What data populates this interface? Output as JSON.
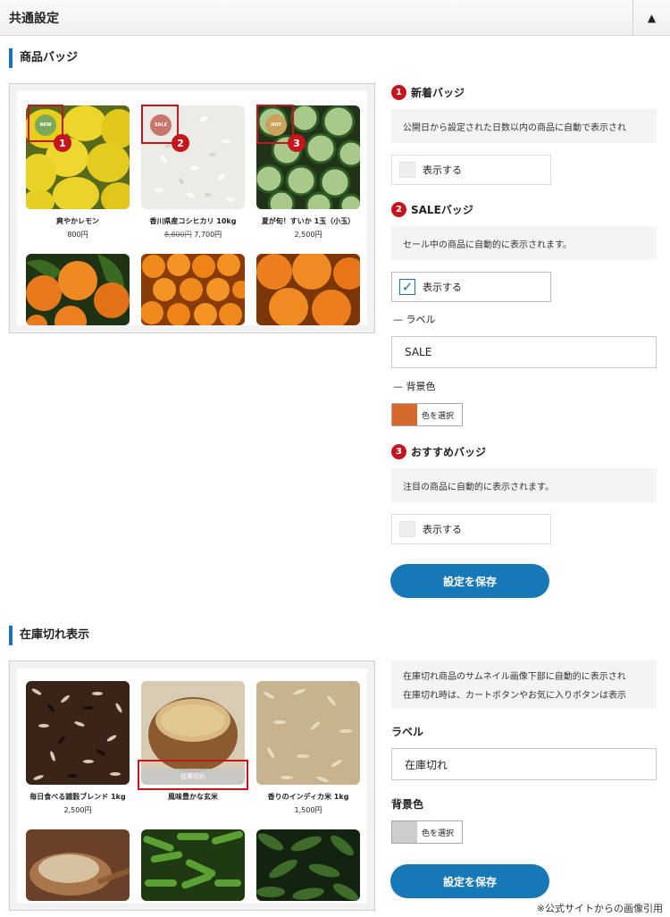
{
  "header": {
    "title": "共通設定",
    "collapse_icon": "▲"
  },
  "badges_section": {
    "title": "商品バッジ",
    "products": [
      {
        "name": "爽やかレモン",
        "price": "800円",
        "old_price": "",
        "badge": "NEW",
        "badge_color": "#7ca85a"
      },
      {
        "name": "香川県産コシヒカリ 10kg",
        "price": "7,700円",
        "old_price": "8,800円",
        "badge": "SALE",
        "badge_color": "#c9776c"
      },
      {
        "name": "夏が旬！すいか 1玉（小玉）",
        "price": "2,500円",
        "old_price": "",
        "badge": "HOT",
        "badge_color": "#c9a35c"
      }
    ],
    "markers": [
      "1",
      "2",
      "3"
    ],
    "new_badge": {
      "num": "1",
      "title": "新着バッジ",
      "desc": "公開日から設定された日数以内の商品に自動で表示され",
      "checkbox_label": "表示する",
      "checked": false
    },
    "sale_badge": {
      "num": "2",
      "title": "SALEバッジ",
      "desc": "セール中の商品に自動的に表示されます。",
      "checkbox_label": "表示する",
      "checked": true,
      "label_title": "ラベル",
      "label_value": "SALE",
      "bg_title": "背景色",
      "color": "#d4692c",
      "color_button": "色を選択"
    },
    "recommend_badge": {
      "num": "3",
      "title": "おすすめバッジ",
      "desc": "注目の商品に自動的に表示されます。",
      "checkbox_label": "表示する",
      "checked": false
    },
    "save_label": "設定を保存"
  },
  "soldout_section": {
    "title": "在庫切れ表示",
    "products": [
      {
        "name": "毎日食べる雑穀ブレンド 1kg",
        "price": "2,500円"
      },
      {
        "name": "風味豊かな玄米",
        "price": "",
        "soldout": "在庫切れ"
      },
      {
        "name": "香りのインディカ米 1kg",
        "price": "1,500円"
      }
    ],
    "desc_lines": [
      "在庫切れ商品のサムネイル画像下部に自動的に表示され",
      "在庫切れ時は、カートボタンやお気に入りボタンは表示"
    ],
    "label_title": "ラベル",
    "label_value": "在庫切れ",
    "bg_title": "背景色",
    "color": "#cccccc",
    "color_button": "色を選択",
    "save_label": "設定を保存"
  },
  "footnote": "※公式サイトからの画像引用"
}
